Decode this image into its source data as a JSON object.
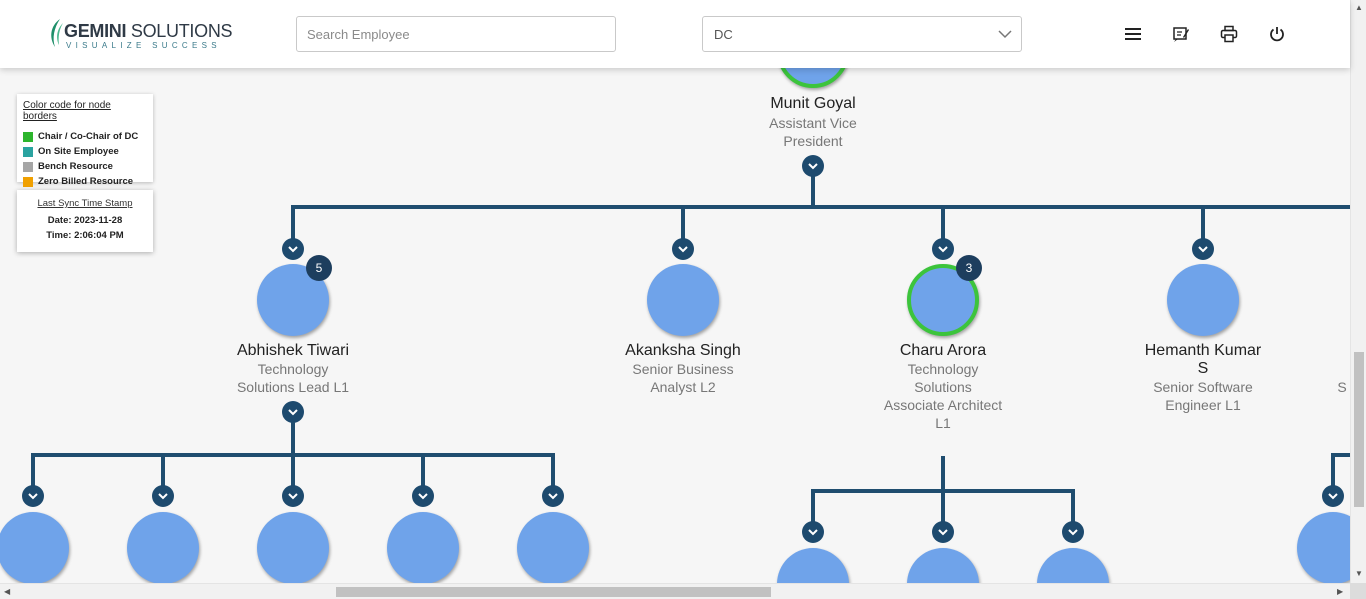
{
  "header": {
    "logo_name_bold": "GEMINI",
    "logo_name_rest": " SOLUTIONS",
    "logo_tagline": "VISUALIZE SUCCESS",
    "search_placeholder": "Search Employee",
    "dc_select_value": "DC",
    "icons": [
      "menu-icon",
      "notes-icon",
      "print-icon",
      "power-icon"
    ]
  },
  "legend": {
    "title": "Color code for node borders",
    "items": [
      {
        "label": "Chair / Co-Chair of DC",
        "color": "#2db52d"
      },
      {
        "label": "On Site Employee",
        "color": "#2aa3a0"
      },
      {
        "label": "Bench Resource",
        "color": "#a6a6a6"
      },
      {
        "label": "Zero Billed Resource",
        "color": "#f0a000"
      }
    ]
  },
  "sync": {
    "title": "Last Sync Time Stamp",
    "date": "Date: 2023-11-28",
    "time": "Time: 2:06:04 PM"
  },
  "colors": {
    "node_fill": "#6fa3ea",
    "connector": "#1f4d6f",
    "chair_border": "#3cc43c"
  },
  "tree": {
    "root": {
      "name": "Munit Goyal",
      "title": [
        "Assistant Vice",
        "President"
      ]
    },
    "children": [
      {
        "name": [
          "Abhishek Tiwari"
        ],
        "title": [
          "Technology",
          "Solutions Lead L1"
        ],
        "count": "5"
      },
      {
        "name": [
          "Akanksha Singh"
        ],
        "title": [
          "Senior Business",
          "Analyst L2"
        ]
      },
      {
        "name": [
          "Charu Arora"
        ],
        "title": [
          "Technology",
          "Solutions",
          "Associate Architect",
          "L1"
        ],
        "count": "3"
      },
      {
        "name": [
          "Hemanth Kumar",
          "S"
        ],
        "title": [
          "Senior Software",
          "Engineer L1"
        ]
      },
      {
        "name": [
          ""
        ],
        "title": [
          "S"
        ]
      }
    ]
  }
}
